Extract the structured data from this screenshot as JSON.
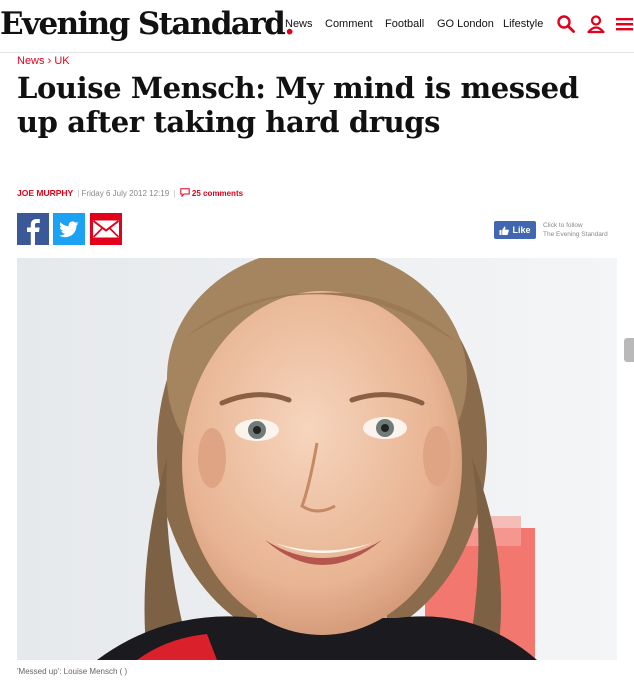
{
  "header": {
    "logo_text": "Evening Standard",
    "logo_dot": ".",
    "nav": [
      "News",
      "Comment",
      "Football",
      "GO London",
      "Lifestyle"
    ],
    "icons": [
      "search-icon",
      "account-icon",
      "menu-icon"
    ],
    "brand_color": "#e3001b"
  },
  "article": {
    "breadcrumb": {
      "section": "News",
      "separator": "›",
      "subsection": "UK"
    },
    "headline": "Louise Mensch: My mind is messed up after taking hard drugs",
    "author": "JOE MURPHY",
    "date": "Friday 6 July 2012 12:19",
    "comments": "25 comments",
    "caption": "'Messed up': Louise Mensch ( )"
  },
  "social": {
    "share": [
      "facebook-icon",
      "twitter-icon",
      "email-icon"
    ],
    "like_label": "Like",
    "follow_line1": "Click to follow",
    "follow_line2": "The Evening Standard"
  }
}
